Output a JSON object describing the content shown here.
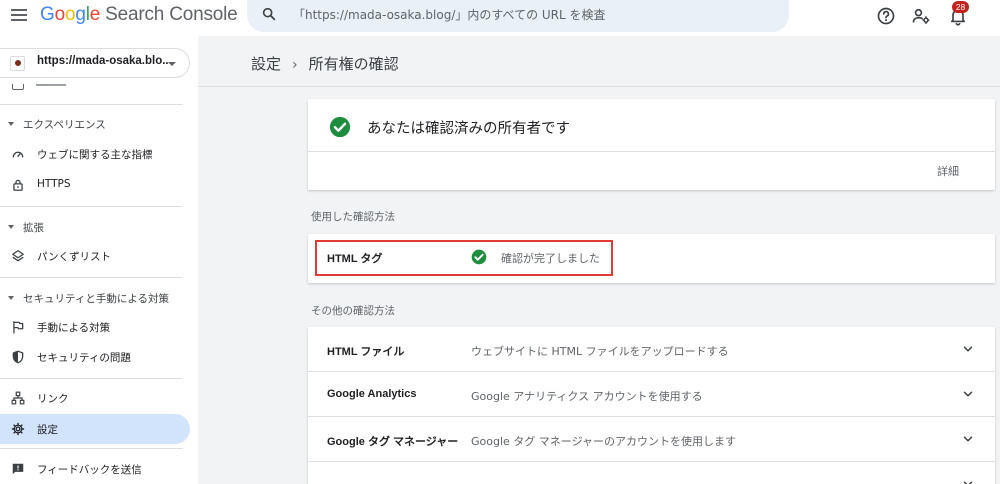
{
  "header": {
    "logo_letters": [
      "G",
      "o",
      "o",
      "g",
      "l",
      "e"
    ],
    "product_name": "Search Console",
    "search_placeholder": "「https://mada-osaka.blog/」内のすべての URL を検査",
    "notification_count": "28",
    "icons": [
      "menu-icon",
      "search-icon",
      "help-icon",
      "manage-users-icon",
      "notifications-icon"
    ]
  },
  "sidebar": {
    "property": "https://mada-osaka.blo...",
    "sections": [
      {
        "label": "エクスペリエンス",
        "items": [
          {
            "label": "ウェブに関する主な指標",
            "icon": "speedometer-icon"
          },
          {
            "label": "HTTPS",
            "icon": "lock-icon"
          }
        ]
      },
      {
        "label": "拡張",
        "items": [
          {
            "label": "パンくずリスト",
            "icon": "layers-icon"
          }
        ]
      },
      {
        "label": "セキュリティと手動による対策",
        "items": [
          {
            "label": "手動による対策",
            "icon": "flag-icon"
          },
          {
            "label": "セキュリティの問題",
            "icon": "shield-icon"
          }
        ]
      }
    ],
    "bottom_items": [
      {
        "label": "リンク",
        "icon": "sitemap-icon"
      },
      {
        "label": "設定",
        "icon": "gear-icon",
        "active": true
      },
      {
        "label": "フィードバックを送信",
        "icon": "feedback-icon"
      }
    ]
  },
  "main": {
    "breadcrumb": {
      "parent": "設定",
      "separator": "›",
      "current": "所有権の確認"
    },
    "owner_card": {
      "title": "あなたは確認済みの所有者です",
      "detail_link": "詳細"
    },
    "used_method": {
      "heading": "使用した確認方法",
      "name": "HTML タグ",
      "status": "確認が完了しました"
    },
    "other_methods": {
      "heading": "その他の確認方法",
      "items": [
        {
          "name": "HTML ファイル",
          "description": "ウェブサイトに HTML ファイルをアップロードする"
        },
        {
          "name": "Google Analytics",
          "description": "Google アナリティクス アカウントを使用する"
        },
        {
          "name": "Google タグ マネージャー",
          "description": "Google タグ マネージャーのアカウントを使用します"
        }
      ]
    }
  },
  "colors": {
    "accent_green": "#1e8e3e",
    "active_nav_bg": "#d2e3fc",
    "highlight_red": "#e53935",
    "badge_red": "#c5221f"
  }
}
